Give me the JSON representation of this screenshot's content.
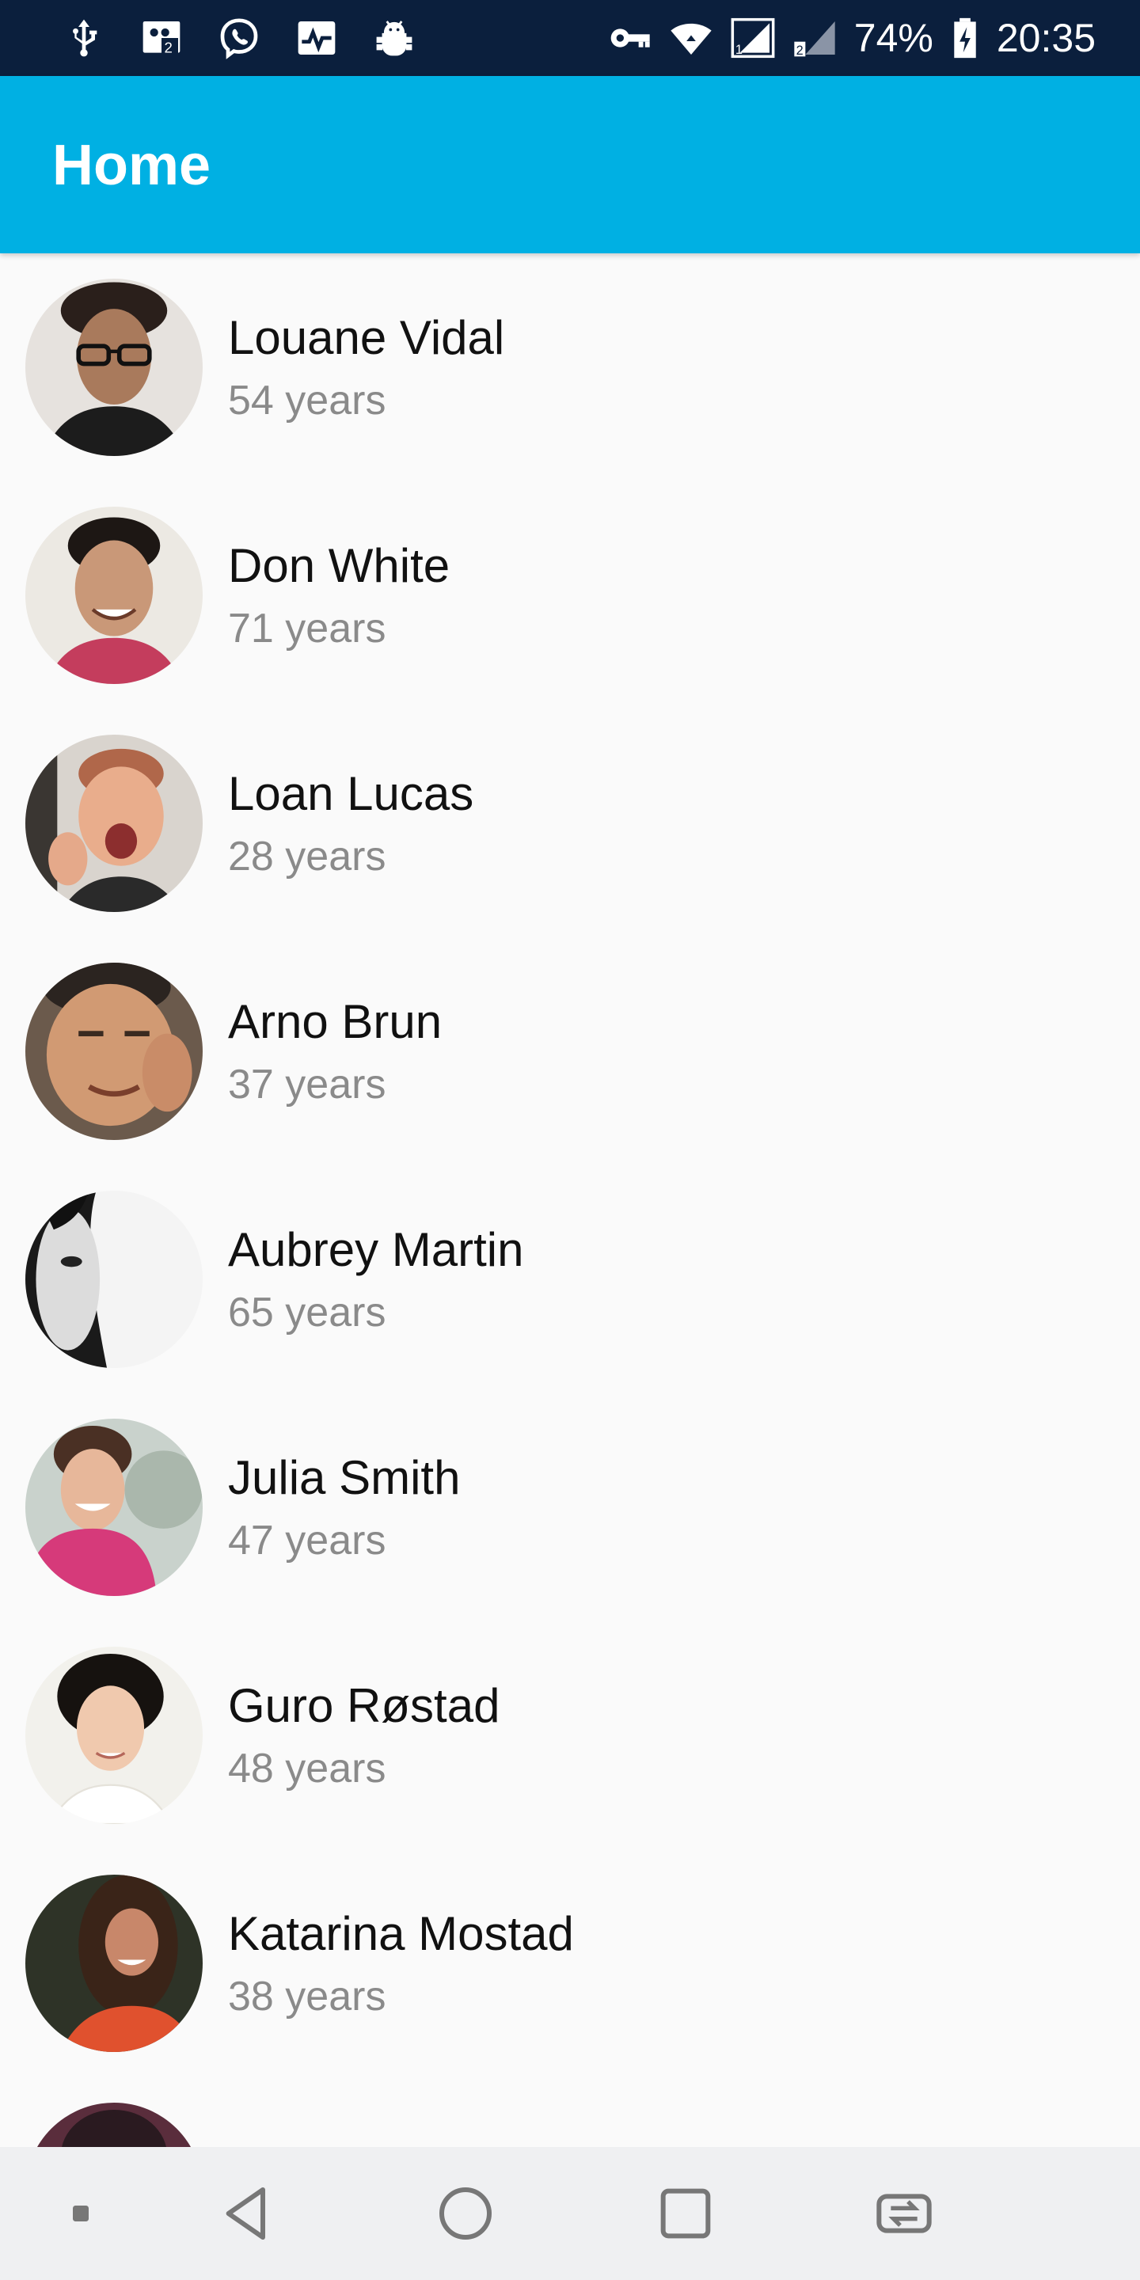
{
  "status_bar": {
    "battery": "74%",
    "time": "20:35",
    "left_icons": [
      "usb-icon",
      "sms-icon",
      "viber-icon",
      "activity-icon",
      "android-debug-icon"
    ],
    "right_icons": [
      "vpn-key-icon",
      "wifi-icon",
      "signal-sim1-icon",
      "signal-sim2-icon",
      "battery-charging-icon"
    ]
  },
  "app_bar": {
    "title": "Home",
    "background": "#00b0e3"
  },
  "list": {
    "items": [
      {
        "name": "Louane Vidal",
        "age": "54 years"
      },
      {
        "name": "Don White",
        "age": "71 years"
      },
      {
        "name": "Loan Lucas",
        "age": "28 years"
      },
      {
        "name": "Arno Brun",
        "age": "37 years"
      },
      {
        "name": "Aubrey Martin",
        "age": "65 years"
      },
      {
        "name": "Julia Smith",
        "age": "47 years"
      },
      {
        "name": "Guro Røstad",
        "age": "48 years"
      },
      {
        "name": "Katarina Mostad",
        "age": "38 years"
      }
    ]
  },
  "nav_bar": {
    "buttons": [
      "menu-dot-icon",
      "back-icon",
      "home-icon",
      "recents-icon",
      "switch-icon"
    ]
  },
  "colors": {
    "status_bar": "#0b1f3d",
    "accent": "#00b0e3",
    "name_text": "#111111",
    "age_text": "#8a8a8a",
    "list_background": "#fafafa",
    "nav_bar": "#eff0f2"
  }
}
